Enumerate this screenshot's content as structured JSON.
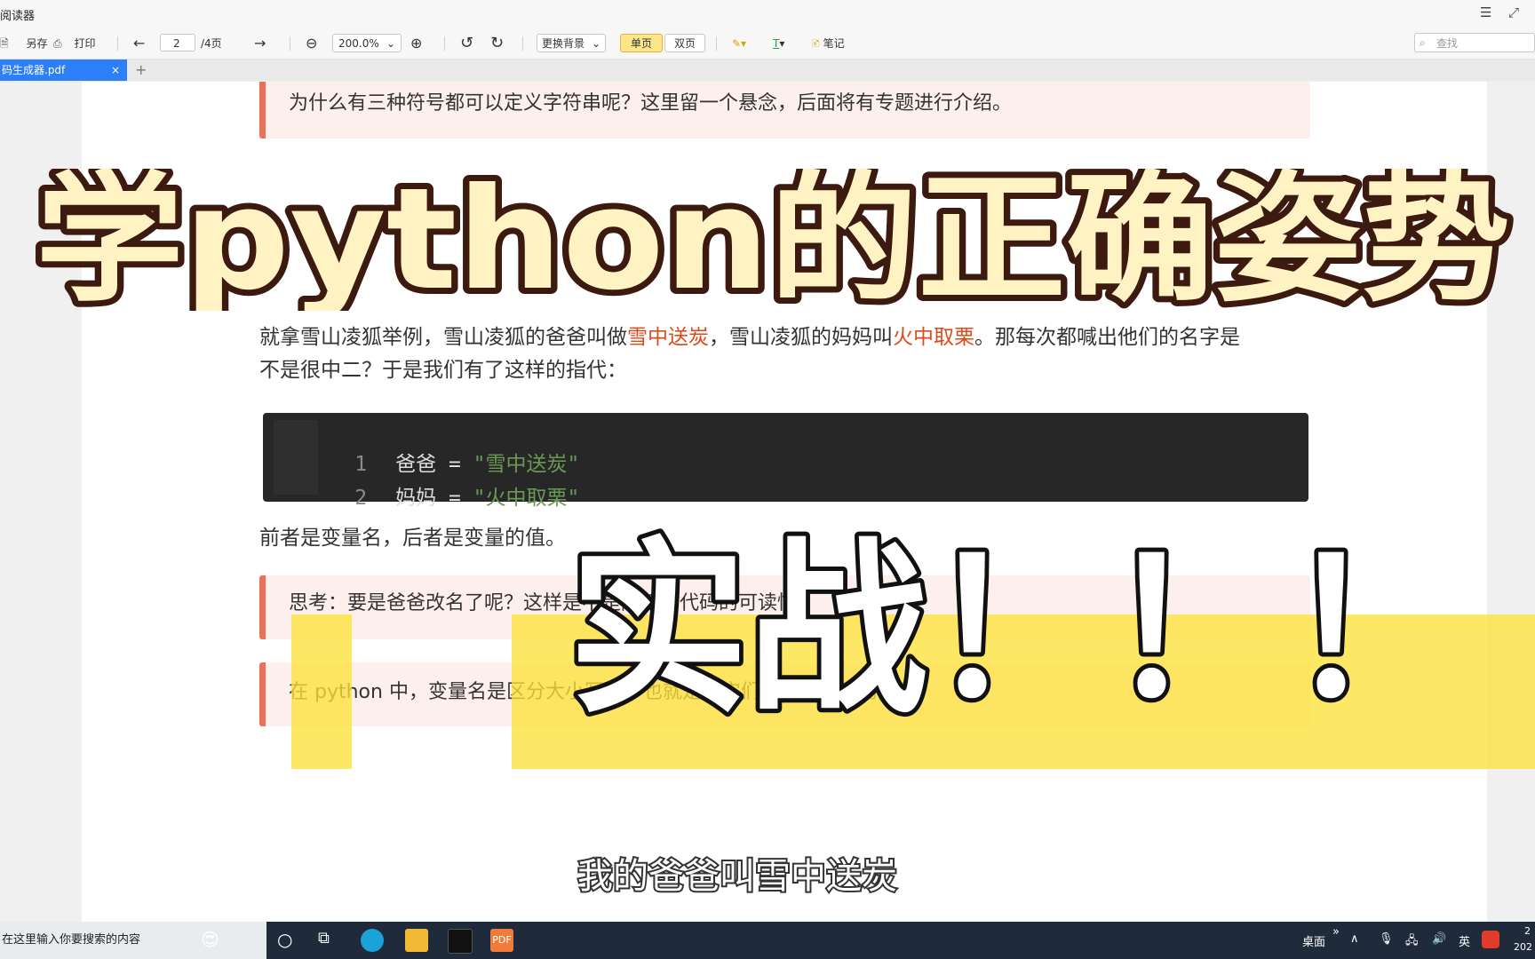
{
  "window": {
    "title": "阅读器",
    "menu_icon": "hamburger-icon",
    "fullscreen_icon": "fullscreen-icon"
  },
  "toolbar": {
    "save_as_label": "另存",
    "print_label": "打印",
    "page_current": "2",
    "page_total": "/4页",
    "zoom_value": "200.0%",
    "background_label": "更换背景",
    "single_page_label": "单页",
    "double_page_label": "双页",
    "note_label": "笔记",
    "search_placeholder": "查找"
  },
  "tabs": [
    {
      "label": "码生成器.pdf",
      "close": "×",
      "active": true
    }
  ],
  "new_tab_label": "+",
  "document": {
    "note1": "为什么有三种符号都可以定义字符串呢？这里留一个悬念，后面将有专题进行介绍。",
    "para1_part1": "就拿雪山凌狐举例，雪山凌狐的爸爸叫做",
    "para1_highlight1": "雪中送炭",
    "para1_part2": "，雪山凌狐的妈妈叫",
    "para1_highlight2": "火中取栗",
    "para1_part3": "。那每次都喊出他们的名字是",
    "para2": "不是很中二？于是我们有了这样的指代：",
    "code_lines": [
      {
        "num": "1",
        "name": "爸爸",
        "op": "=",
        "value": "\"雪中送炭\""
      },
      {
        "num": "2",
        "name": "妈妈",
        "op": "=",
        "value": "\"火中取栗\""
      }
    ],
    "para3": "前者是变量名，后者是变量的值。",
    "note2": "思考：要是爸爸改名了呢？这样是不是降低了代码的可读性？",
    "note3": "在 python 中，变量名是区分大小写的，也就是说它们是两个不同的变量。"
  },
  "overlay": {
    "title": "学python的正确姿势",
    "subtitle_big": "实战！！！",
    "caption": "我的爸爸叫雪中送炭",
    "title_fill": "#fff3c4",
    "title_stroke": "#3d1a0f",
    "highlight_color": "#fde23a"
  },
  "taskbar": {
    "search_placeholder": "在这里输入你要搜索的内容",
    "desktop_label": "桌面",
    "ime_label": "英",
    "time": "2",
    "date": "202"
  }
}
